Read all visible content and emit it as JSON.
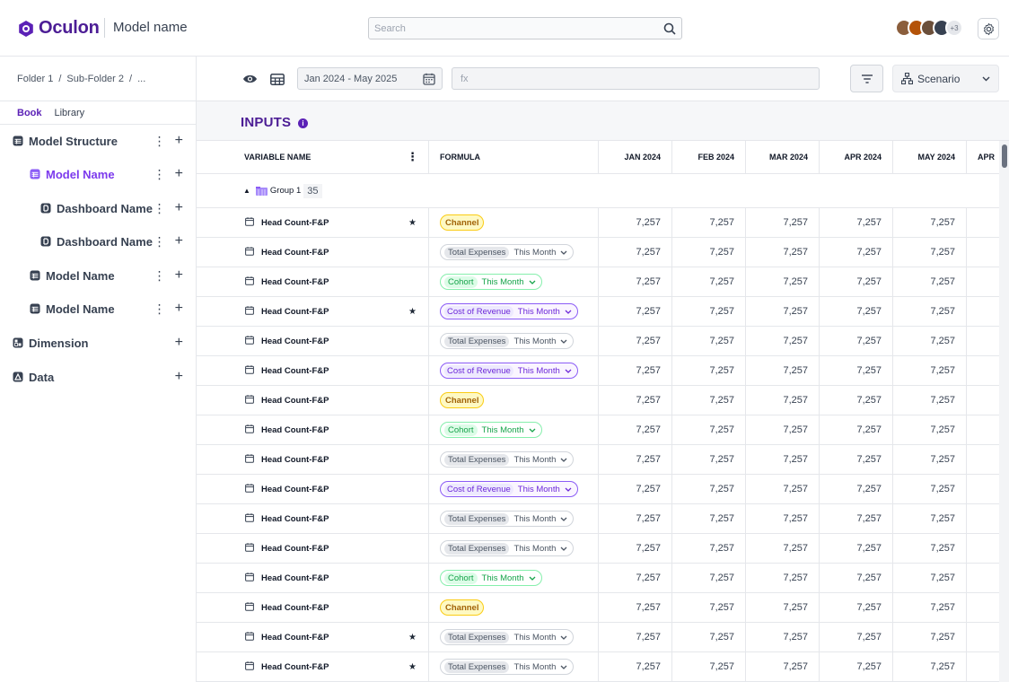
{
  "app": {
    "brand": "Oculon",
    "model_title": "Model name"
  },
  "search": {
    "placeholder": "Search"
  },
  "avatars": {
    "more": "+3"
  },
  "breadcrumb": [
    "Folder 1",
    "/",
    "Sub-Folder 2",
    "/",
    "..."
  ],
  "tabs": [
    "Book",
    "Library"
  ],
  "tree": [
    {
      "label": "Model Structure",
      "level": 0,
      "icon": "table-icon"
    },
    {
      "label": "Model Name",
      "level": 1,
      "icon": "table-icon",
      "active": true
    },
    {
      "label": "Dashboard Name",
      "level": 2,
      "icon": "dashboard-icon"
    },
    {
      "label": "Dashboard Name",
      "level": 2,
      "icon": "dashboard-icon"
    },
    {
      "label": "Model Name",
      "level": 1,
      "icon": "table-icon"
    },
    {
      "label": "Model Name",
      "level": 1,
      "icon": "table-icon"
    },
    {
      "label": "Dimension",
      "level": 0,
      "icon": "dimension-icon"
    },
    {
      "label": "Data",
      "level": 0,
      "icon": "data-icon"
    }
  ],
  "toolbar": {
    "date_range": "Jan 2024 - May 2025",
    "fx_placeholder": "fx",
    "scenario": "Scenario"
  },
  "section": {
    "title": "INPUTS"
  },
  "table": {
    "headers": {
      "variable": "VARIABLE NAME",
      "formula": "FORMULA",
      "months": [
        "JAN 2024",
        "FEB 2024",
        "MAR 2024",
        "APR 2024",
        "MAY 2024",
        "APR"
      ]
    },
    "group": {
      "label": "Group 1",
      "count": "35"
    },
    "rows": [
      {
        "name": "Head Count-F&P",
        "star": true,
        "formula": {
          "type": "channel",
          "key": "Channel"
        },
        "values": [
          "7,257",
          "7,257",
          "7,257",
          "7,257",
          "7,257"
        ]
      },
      {
        "name": "Head Count-F&P",
        "star": false,
        "formula": {
          "type": "total",
          "key": "Total Expenses",
          "val": "This Month"
        },
        "values": [
          "7,257",
          "7,257",
          "7,257",
          "7,257",
          "7,257"
        ]
      },
      {
        "name": "Head Count-F&P",
        "star": false,
        "formula": {
          "type": "cohort",
          "key": "Cohort",
          "val": "This Month"
        },
        "values": [
          "7,257",
          "7,257",
          "7,257",
          "7,257",
          "7,257"
        ]
      },
      {
        "name": "Head Count-F&P",
        "star": true,
        "formula": {
          "type": "cost",
          "key": "Cost of Revenue",
          "val": "This Month"
        },
        "values": [
          "7,257",
          "7,257",
          "7,257",
          "7,257",
          "7,257"
        ]
      },
      {
        "name": "Head Count-F&P",
        "star": false,
        "formula": {
          "type": "total",
          "key": "Total Expenses",
          "val": "This Month"
        },
        "values": [
          "7,257",
          "7,257",
          "7,257",
          "7,257",
          "7,257"
        ]
      },
      {
        "name": "Head Count-F&P",
        "star": false,
        "formula": {
          "type": "cost",
          "key": "Cost of Revenue",
          "val": "This Month"
        },
        "values": [
          "7,257",
          "7,257",
          "7,257",
          "7,257",
          "7,257"
        ]
      },
      {
        "name": "Head Count-F&P",
        "star": false,
        "formula": {
          "type": "channel",
          "key": "Channel"
        },
        "values": [
          "7,257",
          "7,257",
          "7,257",
          "7,257",
          "7,257"
        ]
      },
      {
        "name": "Head Count-F&P",
        "star": false,
        "formula": {
          "type": "cohort",
          "key": "Cohort",
          "val": "This Month"
        },
        "values": [
          "7,257",
          "7,257",
          "7,257",
          "7,257",
          "7,257"
        ]
      },
      {
        "name": "Head Count-F&P",
        "star": false,
        "formula": {
          "type": "total",
          "key": "Total Expenses",
          "val": "This Month"
        },
        "values": [
          "7,257",
          "7,257",
          "7,257",
          "7,257",
          "7,257"
        ]
      },
      {
        "name": "Head Count-F&P",
        "star": false,
        "formula": {
          "type": "cost",
          "key": "Cost of Revenue",
          "val": "This Month"
        },
        "values": [
          "7,257",
          "7,257",
          "7,257",
          "7,257",
          "7,257"
        ]
      },
      {
        "name": "Head Count-F&P",
        "star": false,
        "formula": {
          "type": "total",
          "key": "Total Expenses",
          "val": "This Month"
        },
        "values": [
          "7,257",
          "7,257",
          "7,257",
          "7,257",
          "7,257"
        ]
      },
      {
        "name": "Head Count-F&P",
        "star": false,
        "formula": {
          "type": "total",
          "key": "Total Expenses",
          "val": "This Month"
        },
        "values": [
          "7,257",
          "7,257",
          "7,257",
          "7,257",
          "7,257"
        ]
      },
      {
        "name": "Head Count-F&P",
        "star": false,
        "formula": {
          "type": "cohort",
          "key": "Cohort",
          "val": "This Month"
        },
        "values": [
          "7,257",
          "7,257",
          "7,257",
          "7,257",
          "7,257"
        ]
      },
      {
        "name": "Head Count-F&P",
        "star": false,
        "formula": {
          "type": "channel",
          "key": "Channel"
        },
        "values": [
          "7,257",
          "7,257",
          "7,257",
          "7,257",
          "7,257"
        ]
      },
      {
        "name": "Head Count-F&P",
        "star": true,
        "formula": {
          "type": "total",
          "key": "Total Expenses",
          "val": "This Month"
        },
        "values": [
          "7,257",
          "7,257",
          "7,257",
          "7,257",
          "7,257"
        ]
      },
      {
        "name": "Head Count-F&P",
        "star": true,
        "formula": {
          "type": "total",
          "key": "Total Expenses",
          "val": "This Month"
        },
        "values": [
          "7,257",
          "7,257",
          "7,257",
          "7,257",
          "7,257"
        ]
      }
    ]
  },
  "colors": {
    "brand": "#4c1d95",
    "accent": "#7c3aed",
    "channel": "#facc15",
    "cohort": "#16a34a",
    "cost": "#6d28d9"
  }
}
